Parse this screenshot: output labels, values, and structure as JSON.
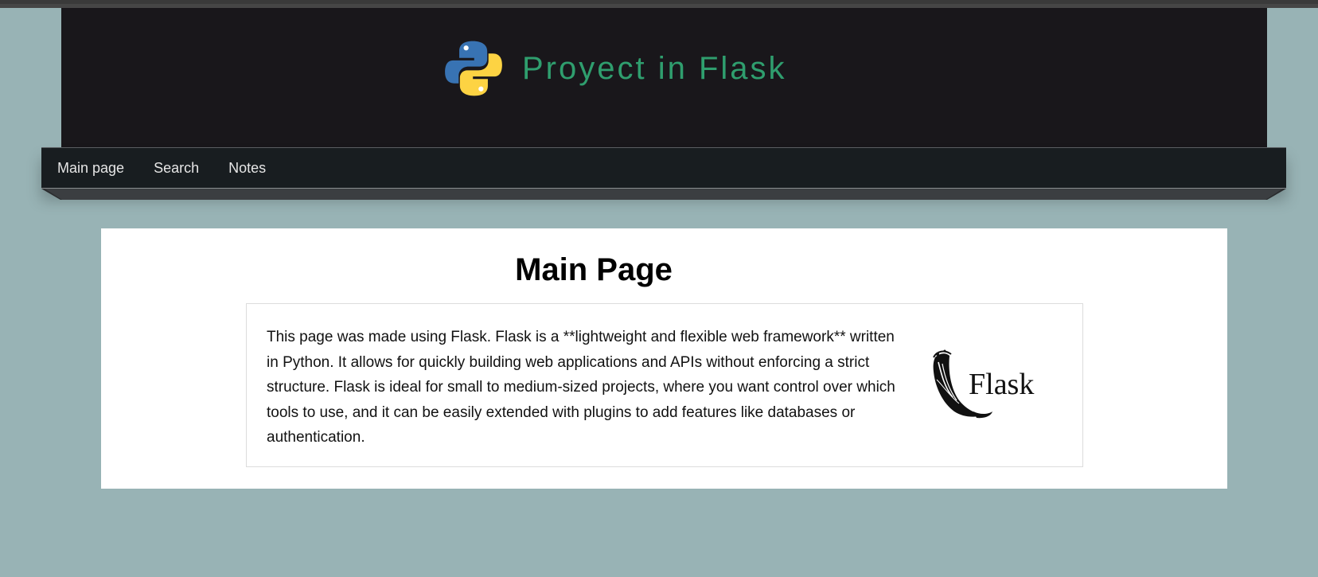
{
  "header": {
    "title": "Proyect in Flask",
    "title_color": "#2f9e6e",
    "logo_icon": "python-logo-icon"
  },
  "nav": {
    "items": [
      {
        "label": "Main page"
      },
      {
        "label": "Search"
      },
      {
        "label": "Notes"
      }
    ]
  },
  "main": {
    "heading": "Main Page",
    "description": "This page was made using Flask. Flask is a **lightweight and flexible web framework** written in Python. It allows for quickly building web applications and APIs without enforcing a strict structure. Flask is ideal for small to medium-sized projects, where you want control over which tools to use, and it can be easily extended with plugins to add features like databases or authentication.",
    "image": {
      "icon": "flask-logo-icon",
      "text": "Flask"
    }
  },
  "colors": {
    "background": "#98b3b5",
    "header_bg": "#19171b",
    "nav_bg": "#181d20"
  }
}
